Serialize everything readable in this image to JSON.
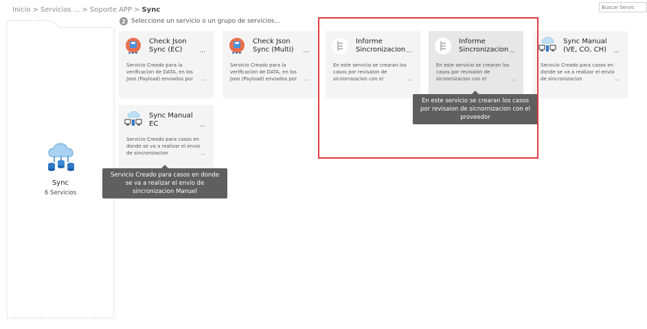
{
  "breadcrumb": {
    "items": [
      "Inicio",
      "Servicios ...",
      "Soporte APP"
    ],
    "separator": ">",
    "current": "Sync"
  },
  "search": {
    "placeholder": "Buscar Servic"
  },
  "step": {
    "number": "2",
    "label": "Seleccione un servicio o un grupo de servicios..."
  },
  "group": {
    "title": "Sync",
    "count": "6 Servicios",
    "icon": "cloud-network-icon"
  },
  "cards": [
    {
      "title": "Check Json Sync (EC)",
      "more": "...",
      "desc": "Servicio Creado para la verificacion de DATA, en los Json (Payload) enviados por",
      "desc_more": "...",
      "icon": "disk-user-icon"
    },
    {
      "title": "Check Json Sync (Multi)",
      "more": "...",
      "desc": "Servicio Creado para la verificacion de DATA, en los Json (Payload) enviados por",
      "desc_more": "...",
      "icon": "disk-user-icon"
    },
    {
      "title": "Informe Sincronizacion",
      "more": "...",
      "desc": "En este servicio se crearan los casos por revisaion de sicnornizacion con el",
      "desc_more": "...",
      "icon": "document-tree-icon"
    },
    {
      "title": "Informe Sincronizacion",
      "more": "...",
      "desc": "En este servicio se crearan los casos por revisaion de sicnornizacion con el",
      "desc_more": "...",
      "icon": "document-tree-icon"
    },
    {
      "title": "Sync Manual (VE, CO, CH)",
      "more": "...",
      "desc": "Servicio Creado para casos en donde se va a realizar el envio de sincronizacion",
      "desc_more": "...",
      "icon": "computer-sync-icon"
    },
    {
      "title": "Sync Manual EC",
      "more": "...",
      "desc": "Servicio Creado para casos en donde se va a realizar el envio de sincronizacion",
      "desc_more": "...",
      "icon": "computer-sync-icon"
    }
  ],
  "tooltips": {
    "informe": "En este servicio se crearan los casos por revisaion de sicnornizacion con el proveedor",
    "sync_ec": "Servicio Creado para casos en donde se va a realizar el envio de sincronizacion Manuel"
  },
  "colors": {
    "highlight": "#e0393b",
    "card_bg": "#f4f4f4",
    "tooltip_bg": "#5f5f5f"
  }
}
